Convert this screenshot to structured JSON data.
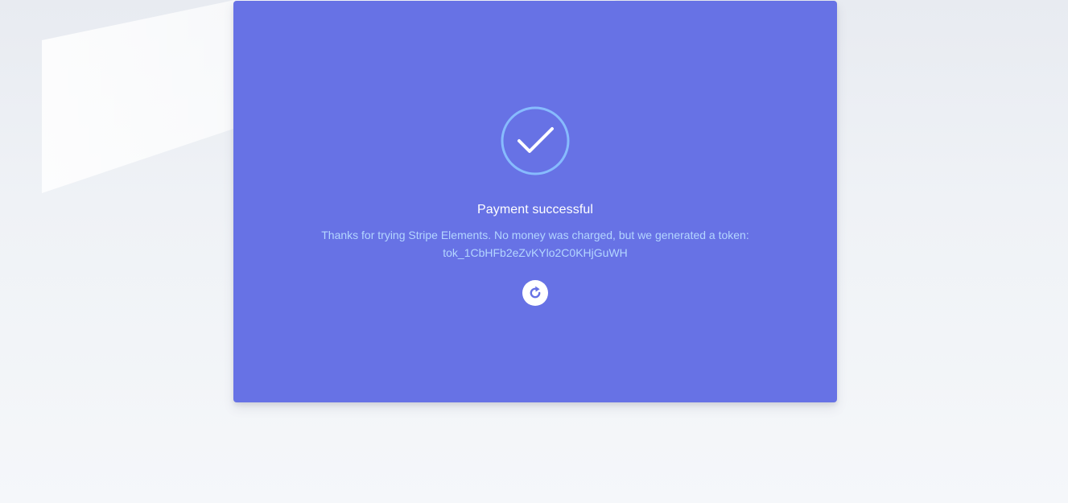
{
  "result": {
    "title": "Payment successful",
    "message": "Thanks for trying Stripe Elements. No money was charged, but we generated a token:",
    "token": "tok_1CbHFb2eZvKYlo2C0KHjGuWH",
    "success_icon": "checkmark-circle-icon",
    "reset_icon": "refresh-icon"
  },
  "colors": {
    "card": "#6772e5",
    "icon_ring": "#87bbfd",
    "message_text": "#b4d6ff",
    "title_text": "#ffffff"
  }
}
